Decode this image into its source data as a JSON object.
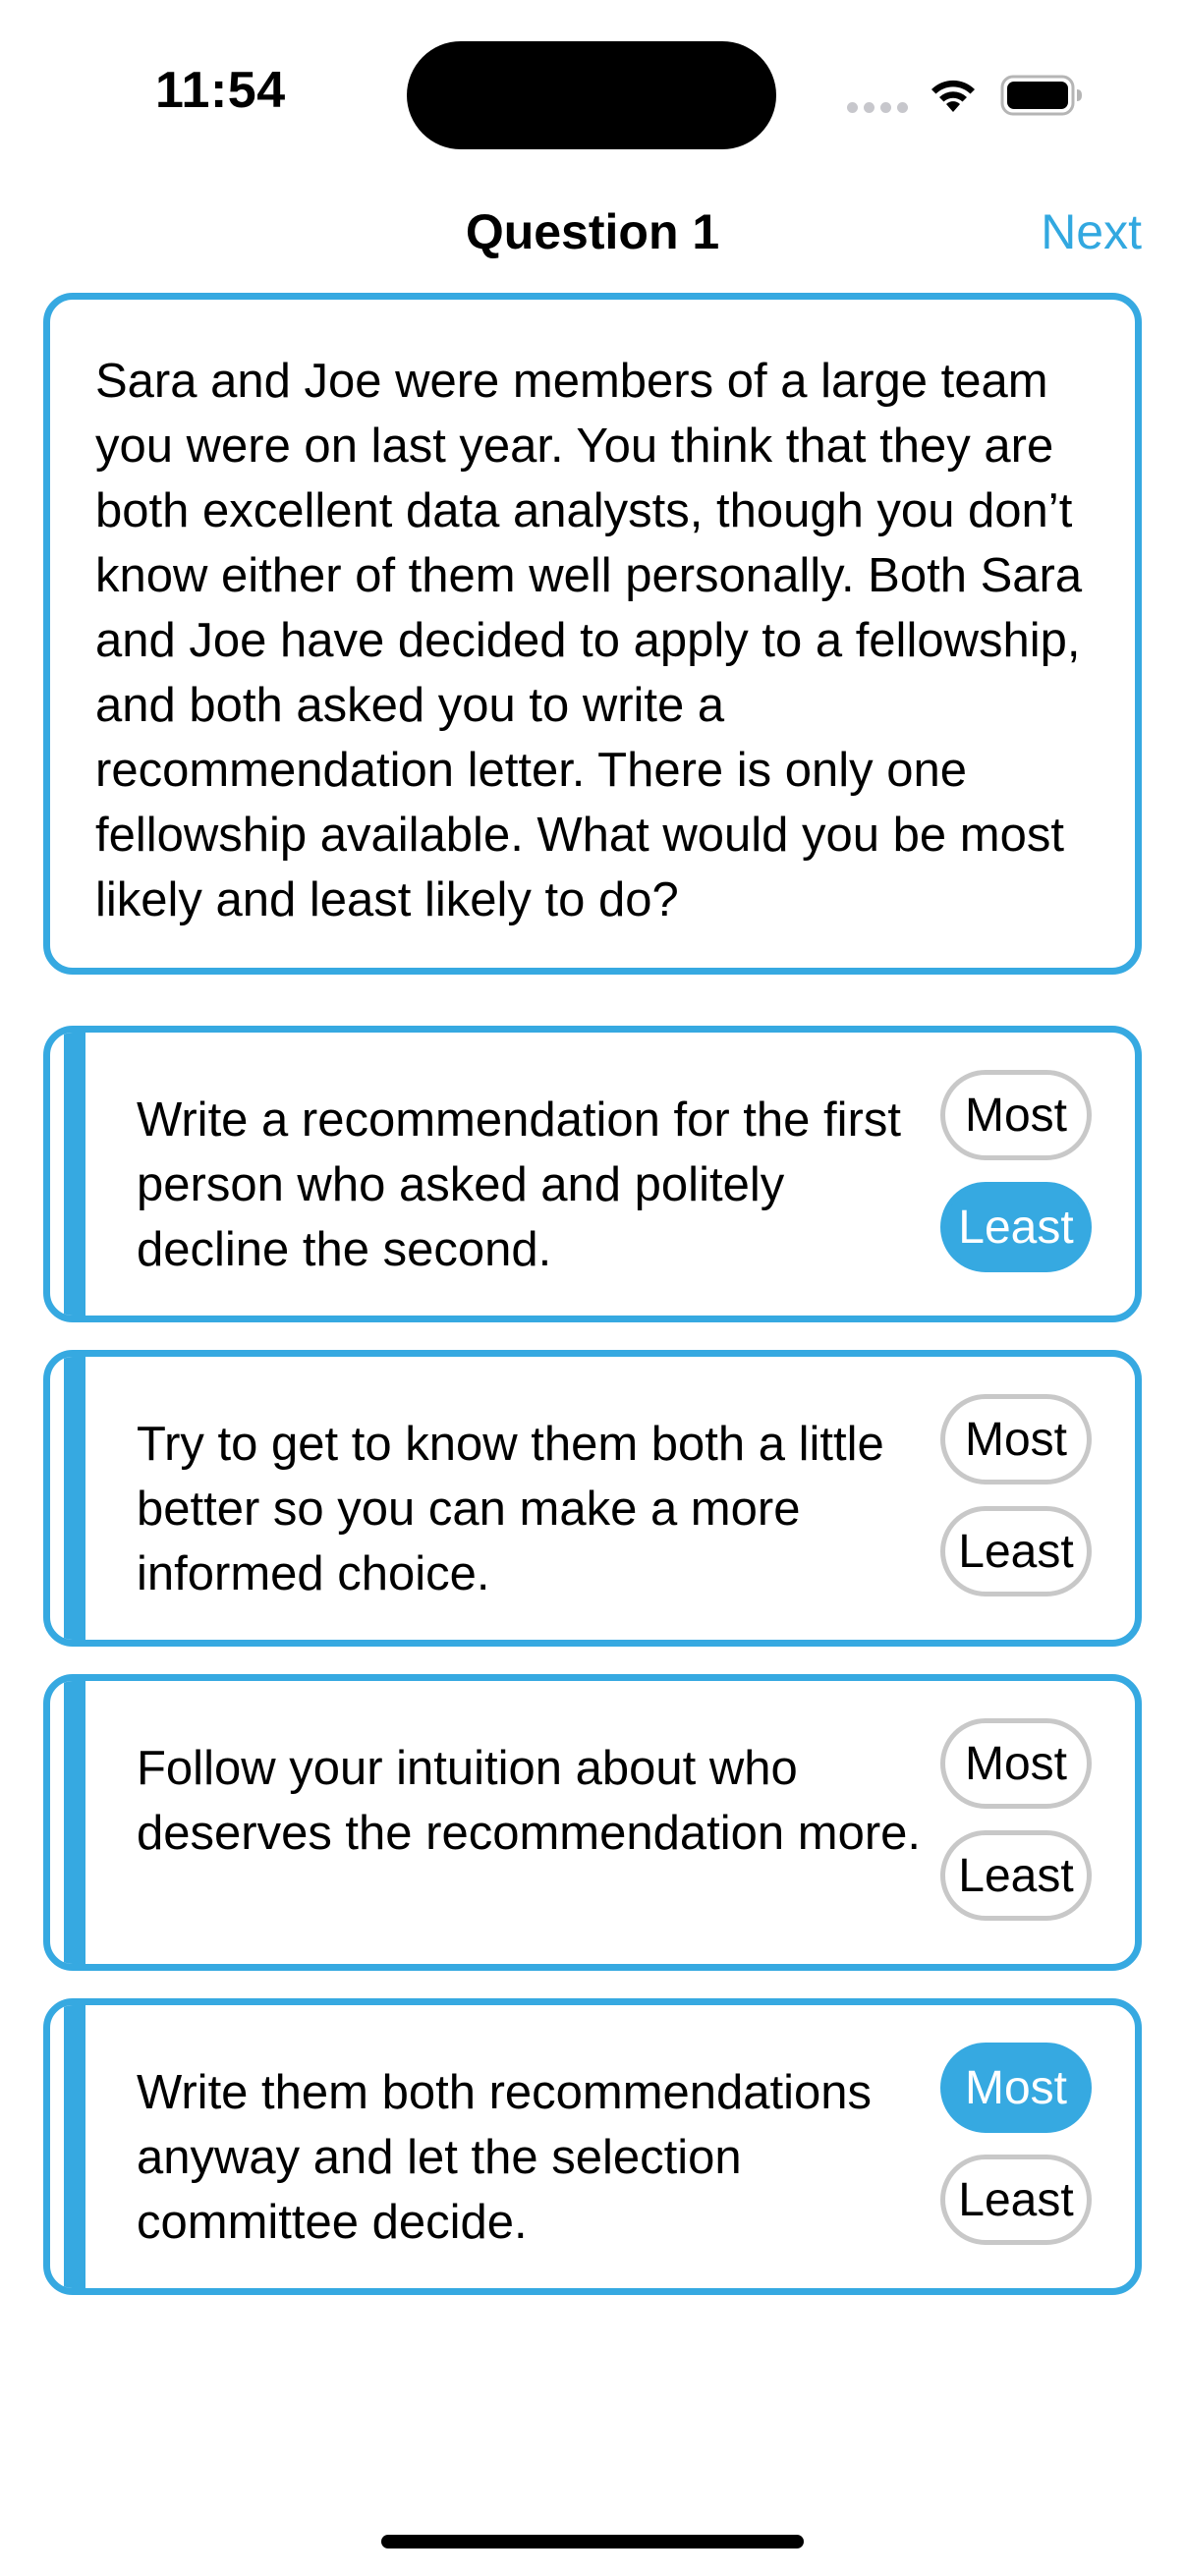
{
  "status_bar": {
    "time": "11:54",
    "signal_icon": "cellular-signal-icon",
    "wifi_icon": "wifi-icon",
    "battery_icon": "battery-icon"
  },
  "nav": {
    "title": "Question 1",
    "next_label": "Next"
  },
  "question": {
    "text": "Sara and Joe were members of a large team you were on last year. You think that they are both excellent data analysts, though you don’t know either of them well personally. Both Sara and Joe have decided to apply to a fellowship, and both asked you to write a recommendation letter. There is only one fellowship available. What would you be most likely and least likely to do?"
  },
  "colors": {
    "accent": "#36a9e1",
    "link": "#32a8e0",
    "unselected_border": "#c8c8c8"
  },
  "options": [
    {
      "text": "Write a recommendation for the first person who asked and politely decline the second.",
      "most_label": "Most",
      "least_label": "Least",
      "selected": "least"
    },
    {
      "text": "Try to get to know them both a little better so you can make a more informed choice.",
      "most_label": "Most",
      "least_label": "Least",
      "selected": "none"
    },
    {
      "text": "Follow your intuition about who deserves the recommendation more.",
      "most_label": "Most",
      "least_label": "Least",
      "selected": "none"
    },
    {
      "text": "Write them both recommendations anyway and let the selection committee decide.",
      "most_label": "Most",
      "least_label": "Least",
      "selected": "most"
    }
  ]
}
